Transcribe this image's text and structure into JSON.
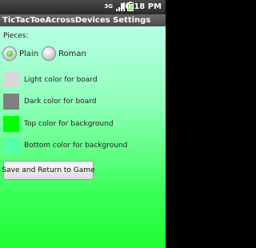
{
  "status_bar": {
    "network": "3G",
    "clock": "10:18 PM"
  },
  "title": "TicTacToeAcrossDevices Settings",
  "pieces": {
    "label": "Pieces:",
    "options": [
      {
        "label": "Plain",
        "selected": true
      },
      {
        "label": "Roman",
        "selected": false
      }
    ]
  },
  "colors": [
    {
      "label": "Light color for board",
      "color": "#d8d8d8"
    },
    {
      "label": "Dark color for board",
      "color": "#808080"
    },
    {
      "label": "Top color for background",
      "color": "#00ff00"
    },
    {
      "label": "Bottom color for background",
      "color": "#55ffaa"
    }
  ],
  "save_button": "Save and Return to Game"
}
